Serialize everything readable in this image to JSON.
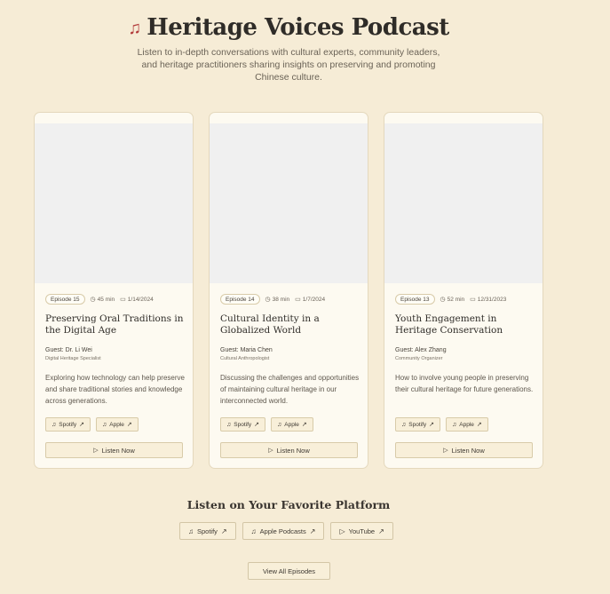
{
  "header": {
    "title": "Heritage Voices Podcast",
    "icon": "music-note-icon",
    "subtitle": "Listen to in-depth conversations with cultural experts, community leaders, and heritage practitioners sharing insights on preserving and promoting Chinese culture."
  },
  "episodes": [
    {
      "badge": "Episode 15",
      "duration": "45 min",
      "date": "1/14/2024",
      "title": "Preserving Oral Traditions in the Digital Age",
      "guest": "Guest: Dr. Li Wei",
      "role": "Digital Heritage Specialist",
      "description": "Exploring how technology can help preserve and share traditional stories and knowledge across generations.",
      "spotify": "Spotify",
      "apple": "Apple",
      "listen": "Listen Now"
    },
    {
      "badge": "Episode 14",
      "duration": "38 min",
      "date": "1/7/2024",
      "title": "Cultural Identity in a Globalized World",
      "guest": "Guest: Maria Chen",
      "role": "Cultural Anthropologist",
      "description": "Discussing the challenges and opportunities of maintaining cultural heritage in our interconnected world.",
      "spotify": "Spotify",
      "apple": "Apple",
      "listen": "Listen Now"
    },
    {
      "badge": "Episode 13",
      "duration": "52 min",
      "date": "12/31/2023",
      "title": "Youth Engagement in Heritage Conservation",
      "guest": "Guest: Alex Zhang",
      "role": "Community Organizer",
      "description": "How to involve young people in preserving their cultural heritage for future generations.",
      "spotify": "Spotify",
      "apple": "Apple",
      "listen": "Listen Now"
    }
  ],
  "platforms": {
    "heading": "Listen on Your Favorite Platform",
    "links": [
      "Spotify",
      "Apple Podcasts",
      "YouTube"
    ]
  },
  "view_all": "View All Episodes",
  "colors": {
    "background": "#f6ecd6",
    "card": "#fdfaf1",
    "accent": "#b23a3a",
    "button": "#f8efd9"
  }
}
